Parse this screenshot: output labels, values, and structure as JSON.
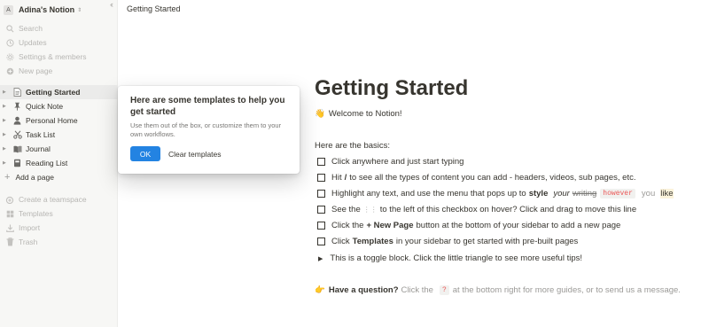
{
  "sidebar": {
    "workspace": {
      "avatar": "A",
      "name": "Adina's Notion",
      "chevron_icon": "chevron-up-down-icon"
    },
    "collapse_icon": "double-chevron-left-icon",
    "nav": [
      {
        "label": "Search",
        "icon": "search-icon"
      },
      {
        "label": "Updates",
        "icon": "clock-icon"
      },
      {
        "label": "Settings & members",
        "icon": "gear-icon"
      },
      {
        "label": "New page",
        "icon": "plus-circle-icon"
      }
    ],
    "pages": [
      {
        "label": "Getting Started",
        "icon": "document-icon",
        "active": true
      },
      {
        "label": "Quick Note",
        "icon": "pin-icon"
      },
      {
        "label": "Personal Home",
        "icon": "person-icon"
      },
      {
        "label": "Task List",
        "icon": "scissors-icon"
      },
      {
        "label": "Journal",
        "icon": "book-icon"
      },
      {
        "label": "Reading List",
        "icon": "books-icon"
      }
    ],
    "add_page": "Add a page",
    "bottom": [
      {
        "label": "Create a teamspace",
        "icon": "teamspace-icon"
      },
      {
        "label": "Templates",
        "icon": "templates-icon"
      },
      {
        "label": "Import",
        "icon": "import-icon"
      },
      {
        "label": "Trash",
        "icon": "trash-icon"
      }
    ]
  },
  "topbar": {
    "breadcrumb": "Getting Started"
  },
  "doc": {
    "title": "Getting Started",
    "welcome": "Welcome to Notion!",
    "basics": "Here are the basics:",
    "todos": {
      "t1": "Click anywhere and just start typing",
      "t2a": "Hit",
      "t2b": "/",
      "t2c": "to see all the types of content you can add - headers, videos, sub pages, etc.",
      "t3a": "Highlight any text, and use the menu that pops up to",
      "t3b": "style",
      "t3c": "your",
      "t3d": "writing",
      "t3e": "however",
      "t3f": "you",
      "t3g": "like",
      "t4a": "See the",
      "t4b": "⋮⋮",
      "t4c": "to the left of this checkbox on hover? Click and drag to move this line",
      "t5a": "Click the",
      "t5b": "+ New Page",
      "t5c": "button at the bottom of your sidebar to add a new page",
      "t6a": "Click",
      "t6b": "Templates",
      "t6c": "in your sidebar to get started with pre-built pages"
    },
    "toggle": "This is a toggle block. Click the little triangle to see more useful tips!",
    "question": {
      "a": "Have a question?",
      "b": "Click the",
      "c": "?",
      "d": "at the bottom right for more guides, or to send us a message."
    }
  },
  "popup": {
    "title": "Here are some templates to help you get started",
    "desc": "Use them out of the box, or customize them to your own workflows.",
    "ok": "OK",
    "clear": "Clear templates"
  },
  "colors": {
    "accent": "#2383e2",
    "sidebar_bg": "#f7f7f5",
    "code_red": "#eb5757"
  }
}
